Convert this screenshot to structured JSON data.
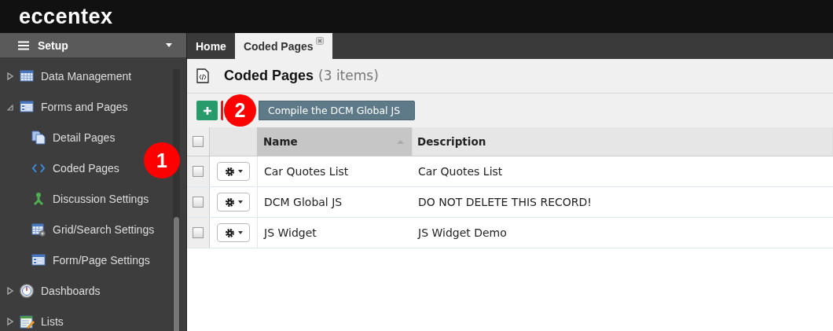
{
  "app": {
    "logo": "eccentex"
  },
  "sidebar": {
    "title": "Setup",
    "items": [
      {
        "label": "Data Management",
        "kind": "table",
        "expanded": false
      },
      {
        "label": "Forms and Pages",
        "kind": "form",
        "expanded": true,
        "children": [
          {
            "label": "Detail Pages",
            "kind": "pages"
          },
          {
            "label": "Coded Pages",
            "kind": "code"
          },
          {
            "label": "Discussion Settings",
            "kind": "branch"
          },
          {
            "label": "Grid/Search Settings",
            "kind": "gridsettings"
          },
          {
            "label": "Form/Page Settings",
            "kind": "form"
          }
        ]
      },
      {
        "label": "Dashboards",
        "kind": "gauge",
        "expanded": false
      },
      {
        "label": "Lists",
        "kind": "list",
        "expanded": false
      }
    ]
  },
  "tabs": [
    {
      "label": "Home",
      "selected": false,
      "closable": false
    },
    {
      "label": "Coded Pages",
      "selected": true,
      "closable": true
    }
  ],
  "page": {
    "title": "Coded Pages",
    "count": "(3 items)"
  },
  "toolbar": {
    "compile_button": "Compile the DCM Global JS"
  },
  "table": {
    "select_all_checked": false,
    "columns": [
      "Name",
      "Description"
    ],
    "rows": [
      {
        "name": "Car Quotes List",
        "description": "Car Quotes List",
        "checked": false
      },
      {
        "name": "DCM Global JS",
        "description": "DO NOT DELETE THIS RECORD!",
        "checked": false
      },
      {
        "name": "JS Widget",
        "description": "JS Widget Demo",
        "checked": false
      }
    ]
  },
  "callouts": [
    {
      "label": "1"
    },
    {
      "label": "2"
    }
  ]
}
